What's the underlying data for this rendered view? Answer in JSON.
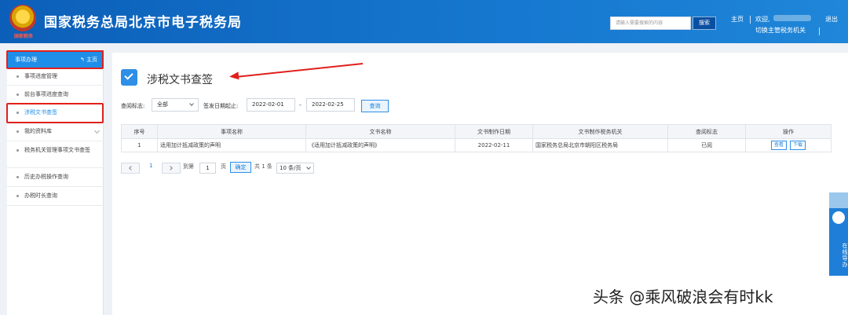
{
  "header": {
    "emblem_caption": "国家税务",
    "brand_title": "国家税务总局北京市电子税务局",
    "search_placeholder": "请输入需要搜索的内容",
    "search_button": "搜索",
    "home_link": "主页",
    "welcome": "欢迎,",
    "logout": "退出",
    "switch_authority": "切换主管税务机关",
    "colors": {
      "bar": "#1678d0",
      "accent_red": "#e0201b"
    }
  },
  "sidebar": {
    "head_title": "事项办理",
    "head_home": "主页",
    "items": [
      {
        "label": "事项进度管理"
      },
      {
        "label": "前台事项进度查询"
      },
      {
        "label": "涉税文书查签",
        "active": true
      },
      {
        "label": "我的资料库",
        "expandable": true
      },
      {
        "label": "税务机关管理事项文书查签"
      },
      {
        "label": "历史办税操作查询"
      },
      {
        "label": "办税时长查询"
      }
    ]
  },
  "main": {
    "page_title": "涉税文书查签",
    "filters": {
      "status_label": "查阅标志:",
      "status_value": "全部",
      "date_label": "签发日期起止:",
      "date_from": "2022-02-01",
      "date_sep": "-",
      "date_to": "2022-02-25",
      "query_button": "查询"
    },
    "table": {
      "columns": [
        "序号",
        "事项名称",
        "文书名称",
        "文书制作日期",
        "文书制作税务机关",
        "查阅标志",
        "操作"
      ],
      "rows": [
        {
          "no": "1",
          "item_name": "适用加计抵减政策的声明",
          "doc_name": "《适用加计抵减政策的声明》",
          "date": "2022-02-11",
          "authority": "国家税务总局北京市朝阳区税务局",
          "status": "已阅",
          "actions": [
            "查看",
            "下载"
          ]
        }
      ]
    },
    "pager": {
      "current_page": "1",
      "goto_label": "到第",
      "page_input": "1",
      "page_unit": "页",
      "go_button": "确定",
      "total": "共 1 条",
      "page_size": "10 条/页"
    }
  },
  "float_widget": {
    "text": "在线导办"
  },
  "watermark": "头条 @乘风破浪会有时kk"
}
